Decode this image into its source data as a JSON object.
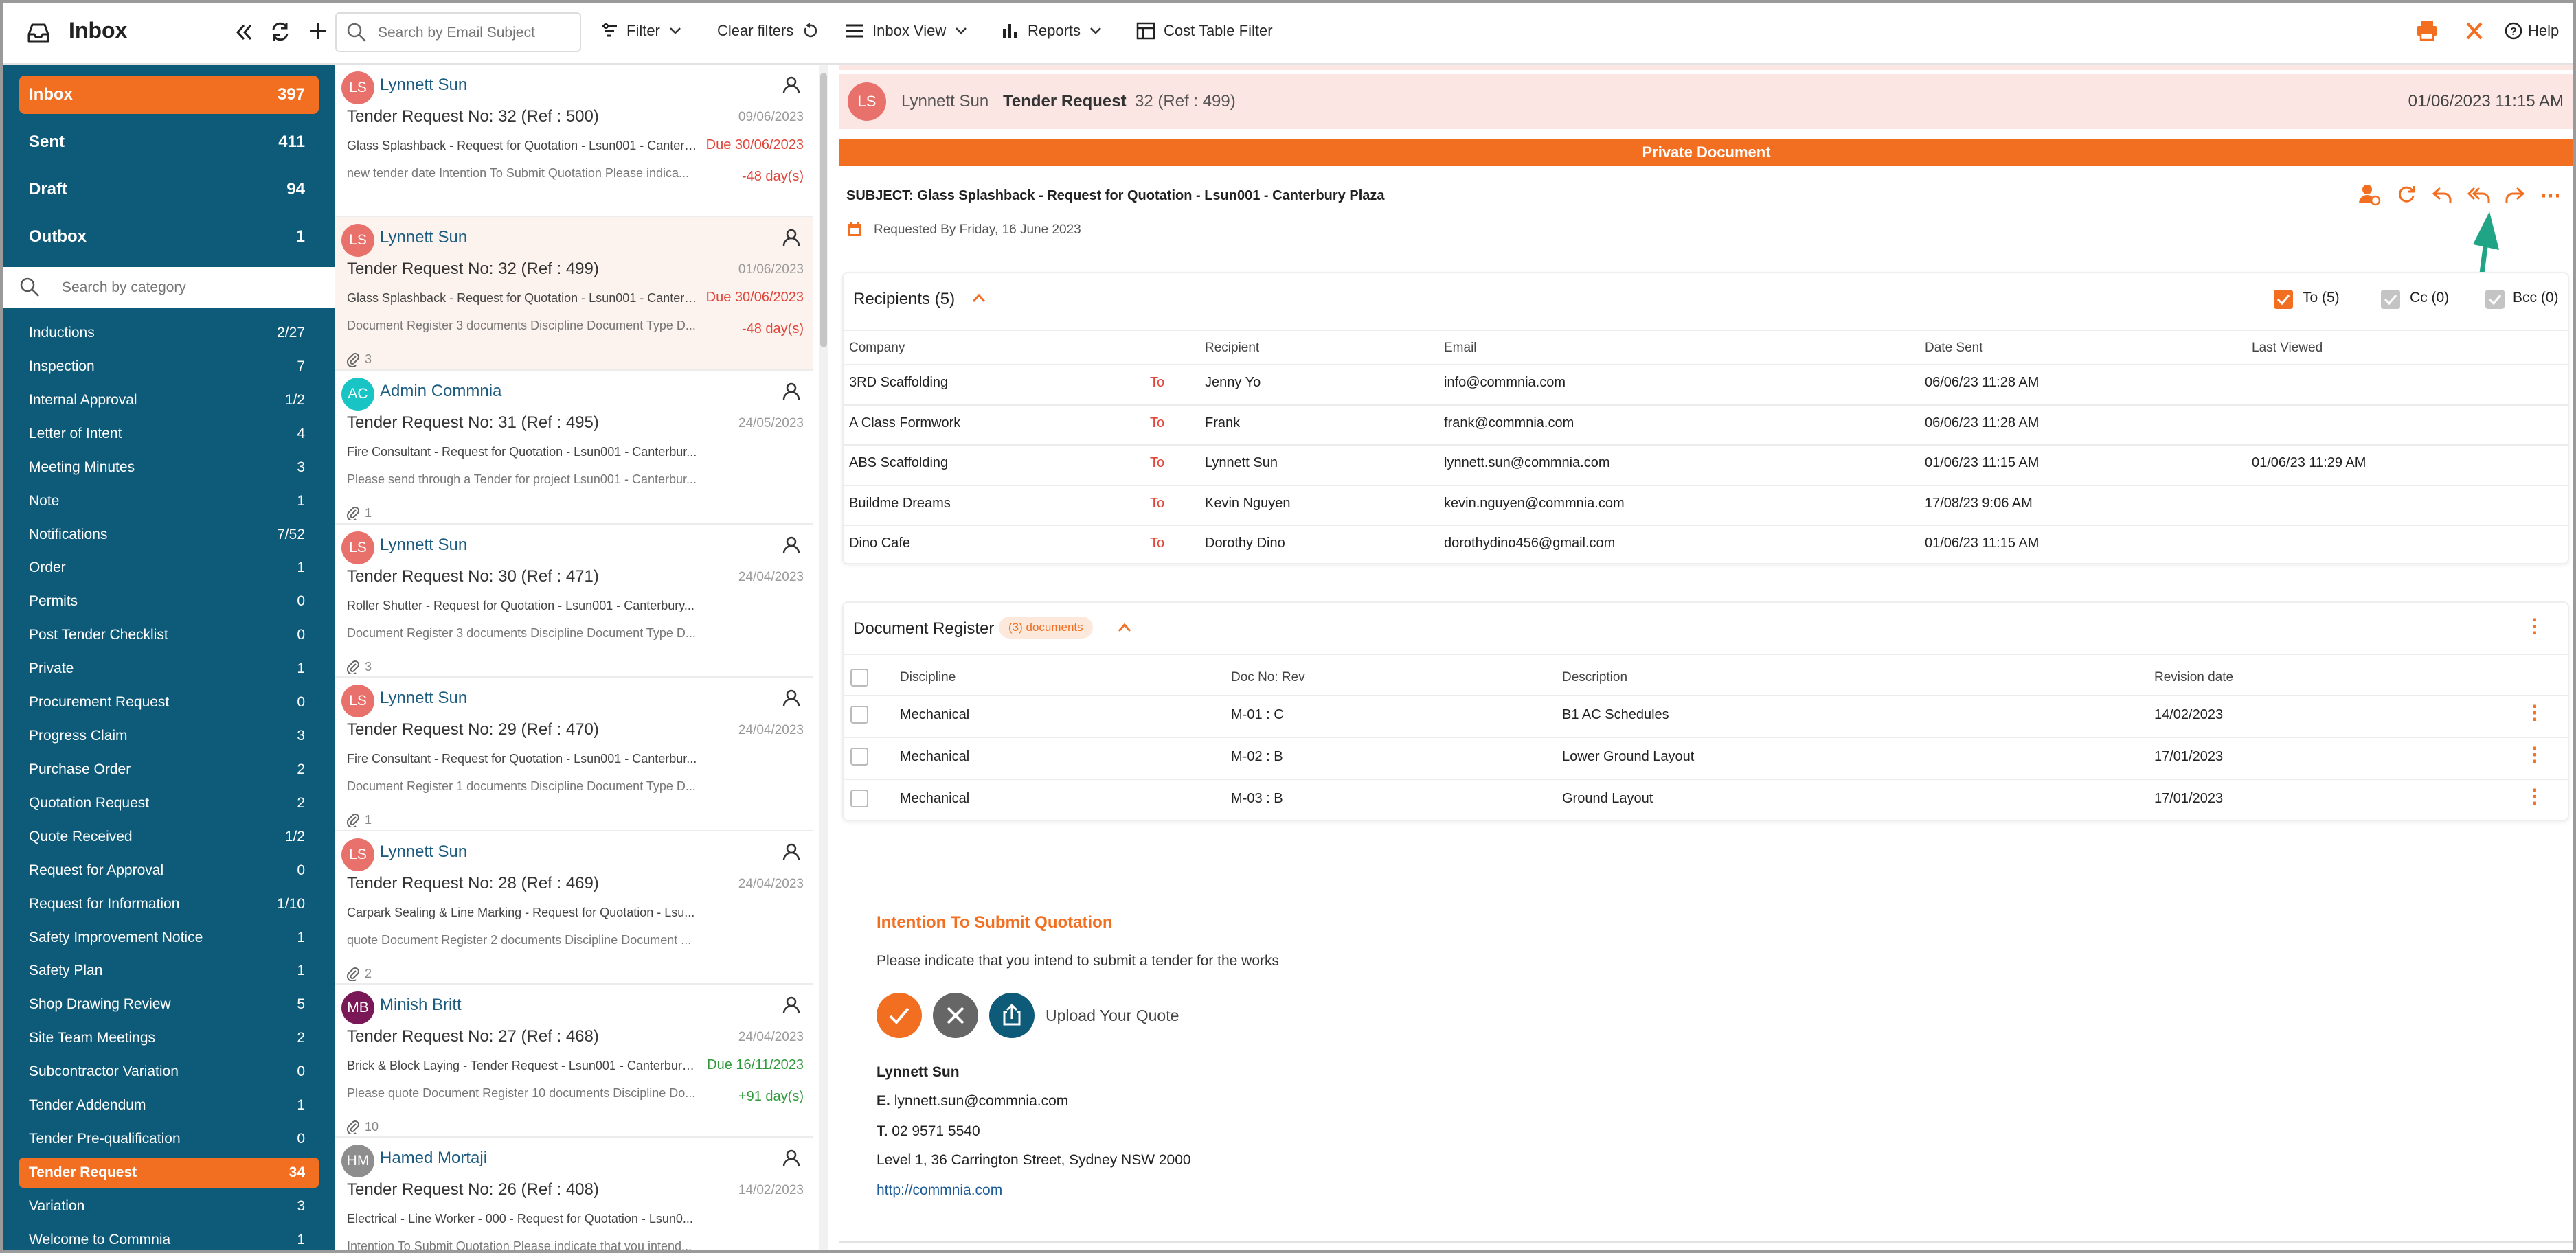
{
  "topbar": {
    "title": "Inbox",
    "search_placeholder": "Search by Email Subject",
    "filter_label": "Filter",
    "clear_filters_label": "Clear filters",
    "inbox_view_label": "Inbox View",
    "reports_label": "Reports",
    "cost_table_filter_label": "Cost Table Filter",
    "help_label": "Help"
  },
  "sidebar": {
    "folders": [
      {
        "label": "Inbox",
        "count": "397"
      },
      {
        "label": "Sent",
        "count": "411"
      },
      {
        "label": "Draft",
        "count": "94"
      },
      {
        "label": "Outbox",
        "count": "1"
      }
    ],
    "category_search_placeholder": "Search by category",
    "categories": [
      {
        "label": "Inductions",
        "count": "2/27"
      },
      {
        "label": "Inspection",
        "count": "7"
      },
      {
        "label": "Internal Approval",
        "count": "1/2"
      },
      {
        "label": "Letter of Intent",
        "count": "4"
      },
      {
        "label": "Meeting Minutes",
        "count": "3"
      },
      {
        "label": "Note",
        "count": "1"
      },
      {
        "label": "Notifications",
        "count": "7/52"
      },
      {
        "label": "Order",
        "count": "1"
      },
      {
        "label": "Permits",
        "count": "0"
      },
      {
        "label": "Post Tender Checklist",
        "count": "0"
      },
      {
        "label": "Private",
        "count": "1"
      },
      {
        "label": "Procurement Request",
        "count": "0"
      },
      {
        "label": "Progress Claim",
        "count": "3"
      },
      {
        "label": "Purchase Order",
        "count": "2"
      },
      {
        "label": "Quotation Request",
        "count": "2"
      },
      {
        "label": "Quote Received",
        "count": "1/2"
      },
      {
        "label": "Request for Approval",
        "count": "0"
      },
      {
        "label": "Request for Information",
        "count": "1/10"
      },
      {
        "label": "Safety Improvement Notice",
        "count": "1"
      },
      {
        "label": "Safety Plan",
        "count": "1"
      },
      {
        "label": "Shop Drawing Review",
        "count": "5"
      },
      {
        "label": "Site Team Meetings",
        "count": "2"
      },
      {
        "label": "Subcontractor Variation",
        "count": "0"
      },
      {
        "label": "Tender Addendum",
        "count": "1"
      },
      {
        "label": "Tender Pre-qualification",
        "count": "0"
      },
      {
        "label": "Tender Request",
        "count": "34"
      },
      {
        "label": "Variation",
        "count": "3"
      },
      {
        "label": "Welcome to Commnia",
        "count": "1"
      }
    ]
  },
  "mails": [
    {
      "initials": "LS",
      "avatar_color": "#e8716b",
      "sender": "Lynnett Sun",
      "subject": "Tender Request No: 32 (Ref : 500)",
      "date": "09/06/2023",
      "line1": "Glass Splashback - Request for Quotation - Lsun001 - Canterb...",
      "line2": "new tender date  Intention To Submit Quotation Please indica...",
      "due": "Due 30/06/2023",
      "days": "-48 day(s)",
      "attachments": ""
    },
    {
      "initials": "LS",
      "avatar_color": "#e8716b",
      "sender": "Lynnett Sun",
      "subject": "Tender Request No: 32 (Ref : 499)",
      "date": "01/06/2023",
      "line1": "Glass Splashback - Request for Quotation - Lsun001 - Canterb...",
      "line2": "Document Register 3 documents Discipline Document Type D...",
      "due": "Due 30/06/2023",
      "days": "-48 day(s)",
      "attachments": "3"
    },
    {
      "initials": "AC",
      "avatar_color": "#18c4c4",
      "sender": "Admin Commnia",
      "subject": "Tender Request No: 31 (Ref : 495)",
      "date": "24/05/2023",
      "line1": "Fire Consultant - Request for Quotation - Lsun001 - Canterbur...",
      "line2": "Please send through a Tender for project Lsun001 - Canterbur...",
      "due": "",
      "days": "",
      "attachments": "1"
    },
    {
      "initials": "LS",
      "avatar_color": "#e8716b",
      "sender": "Lynnett Sun",
      "subject": "Tender Request No: 30 (Ref : 471)",
      "date": "24/04/2023",
      "line1": "Roller Shutter - Request for Quotation - Lsun001 - Canterbury...",
      "line2": "Document Register 3 documents Discipline Document Type D...",
      "due": "",
      "days": "",
      "attachments": "3"
    },
    {
      "initials": "LS",
      "avatar_color": "#e8716b",
      "sender": "Lynnett Sun",
      "subject": "Tender Request No: 29 (Ref : 470)",
      "date": "24/04/2023",
      "line1": "Fire Consultant - Request for Quotation - Lsun001 - Canterbur...",
      "line2": "Document Register 1 documents Discipline Document Type D...",
      "due": "",
      "days": "",
      "attachments": "1"
    },
    {
      "initials": "LS",
      "avatar_color": "#e8716b",
      "sender": "Lynnett Sun",
      "subject": "Tender Request No: 28 (Ref : 469)",
      "date": "24/04/2023",
      "line1": "Carpark Sealing & Line Marking - Request for Quotation - Lsu...",
      "line2": "quote Document Register 2 documents Discipline Document ...",
      "due": "",
      "days": "",
      "attachments": "2"
    },
    {
      "initials": "MB",
      "avatar_color": "#7a1857",
      "sender": "Minish Britt",
      "subject": "Tender Request No: 27 (Ref : 468)",
      "date": "24/04/2023",
      "line1": "Brick & Block Laying - Tender Request - Lsun001 - Canterbury ...",
      "line2": "Please quote Document Register 10 documents Discipline Do...",
      "due": "Due 16/11/2023",
      "days": "+91 day(s)",
      "attachments": "10"
    },
    {
      "initials": "HM",
      "avatar_color": "#8e8e8e",
      "sender": "Hamed Mortaji",
      "subject": "Tender Request No: 26 (Ref : 408)",
      "date": "14/02/2023",
      "line1": "Electrical - Line Worker - 000 - Request for Quotation - Lsun0...",
      "line2": "Intention To Submit Quotation Please indicate that you intend...",
      "due": "",
      "days": "",
      "attachments": ""
    }
  ],
  "detail": {
    "initials": "LS",
    "sender": "Lynnett Sun",
    "type": "Tender Request",
    "number": "32 (Ref : 499)",
    "datetime": "01/06/2023 11:15 AM",
    "private_label": "Private Document",
    "subject": "SUBJECT: Glass Splashback - Request for Quotation - Lsun001 - Canterbury Plaza",
    "requested_by": "Requested By Friday, 16 June 2023",
    "recipients": {
      "title": "Recipients (5)",
      "to_label": "To (5)",
      "cc_label": "Cc (0)",
      "bcc_label": "Bcc (0)",
      "headers": [
        "Company",
        "Recipient",
        "Email",
        "Date Sent",
        "Last Viewed"
      ],
      "rows": [
        {
          "company": "3RD Scaffolding",
          "type": "To",
          "recipient": "Jenny Yo",
          "email": "info@commnia.com",
          "date_sent": "06/06/23 11:28 AM",
          "last_viewed": ""
        },
        {
          "company": "A Class Formwork",
          "type": "To",
          "recipient": "Frank",
          "email": "frank@commnia.com",
          "date_sent": "06/06/23 11:28 AM",
          "last_viewed": ""
        },
        {
          "company": "ABS Scaffolding",
          "type": "To",
          "recipient": "Lynnett Sun",
          "email": "lynnett.sun@commnia.com",
          "date_sent": "01/06/23 11:15 AM",
          "last_viewed": "01/06/23 11:29 AM"
        },
        {
          "company": "Buildme Dreams",
          "type": "To",
          "recipient": "Kevin Nguyen",
          "email": "kevin.nguyen@commnia.com",
          "date_sent": "17/08/23 9:06 AM",
          "last_viewed": ""
        },
        {
          "company": "Dino Cafe",
          "type": "To",
          "recipient": "Dorothy Dino",
          "email": "dorothydino456@gmail.com",
          "date_sent": "01/06/23 11:15 AM",
          "last_viewed": ""
        }
      ]
    },
    "documents": {
      "title": "Document Register",
      "badge": "(3) documents",
      "headers": [
        "Discipline",
        "Doc No: Rev",
        "Description",
        "Revision date"
      ],
      "rows": [
        {
          "discipline": "Mechanical",
          "doc": "M-01 : C",
          "description": "B1 AC Schedules",
          "date": "14/02/2023"
        },
        {
          "discipline": "Mechanical",
          "doc": "M-02 : B",
          "description": "Lower Ground Layout",
          "date": "17/01/2023"
        },
        {
          "discipline": "Mechanical",
          "doc": "M-03 : B",
          "description": "Ground Layout",
          "date": "17/01/2023"
        }
      ]
    },
    "intention": {
      "title": "Intention To Submit Quotation",
      "text": "Please indicate that you intend to submit a tender for the works",
      "upload_label": "Upload Your Quote"
    },
    "signature": {
      "name": "Lynnett Sun",
      "email_label": "E.",
      "email": "lynnett.sun@commnia.com",
      "phone_label": "T.",
      "phone": "02 9571 5540",
      "address": "Level 1, 36 Carrington Street, Sydney NSW 2000",
      "url": "http://commnia.com"
    }
  },
  "colors": {
    "accent": "#f26f22",
    "sidebar": "#0e5a79",
    "arrow": "#1fa585"
  }
}
